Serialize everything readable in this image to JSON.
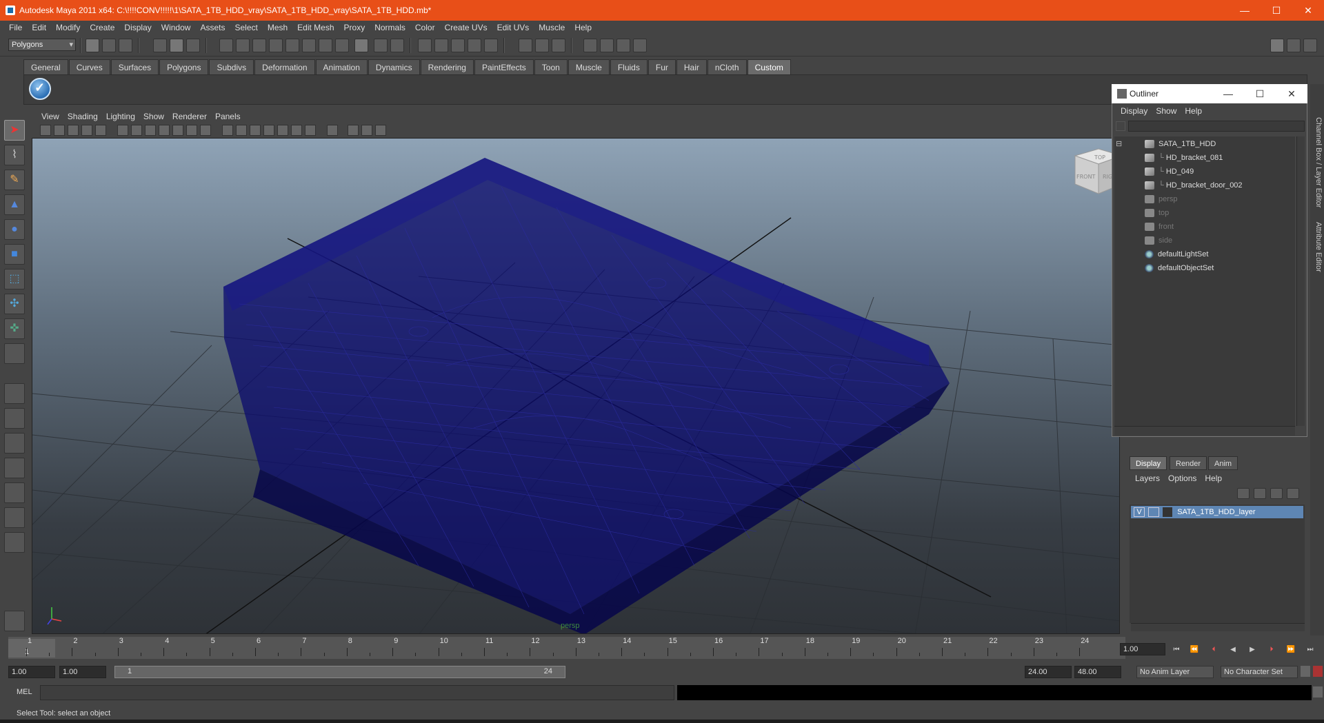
{
  "window": {
    "title": "Autodesk Maya 2011 x64: C:\\!!!!CONV!!!!!\\1\\SATA_1TB_HDD_vray\\SATA_1TB_HDD_vray\\SATA_1TB_HDD.mb*",
    "minimize": "—",
    "maximize": "☐",
    "close": "✕"
  },
  "menubar": [
    "File",
    "Edit",
    "Modify",
    "Create",
    "Display",
    "Window",
    "Assets",
    "Select",
    "Mesh",
    "Edit Mesh",
    "Proxy",
    "Normals",
    "Color",
    "Create UVs",
    "Edit UVs",
    "Muscle",
    "Help"
  ],
  "toolbar": {
    "mode": "Polygons"
  },
  "shelf": {
    "tabs": [
      "General",
      "Curves",
      "Surfaces",
      "Polygons",
      "Subdivs",
      "Deformation",
      "Animation",
      "Dynamics",
      "Rendering",
      "PaintEffects",
      "Toon",
      "Muscle",
      "Fluids",
      "Fur",
      "Hair",
      "nCloth",
      "Custom"
    ],
    "active": "Custom"
  },
  "viewport": {
    "menu": [
      "View",
      "Shading",
      "Lighting",
      "Show",
      "Renderer",
      "Panels"
    ],
    "camera_label": "persp",
    "viewcube": {
      "top": "TOP",
      "front": "FRONT",
      "right": "RIGHT"
    },
    "wire_color": "#0b0b6e"
  },
  "outliner": {
    "title": "Outliner",
    "menu": [
      "Display",
      "Show",
      "Help"
    ],
    "items": [
      {
        "label": "SATA_1TB_HDD",
        "depth": 0,
        "kind": "group",
        "expanded": "⊟"
      },
      {
        "label": "HD_bracket_081",
        "depth": 1,
        "kind": "mesh"
      },
      {
        "label": "HD_049",
        "depth": 1,
        "kind": "mesh"
      },
      {
        "label": "HD_bracket_door_002",
        "depth": 1,
        "kind": "mesh"
      },
      {
        "label": "persp",
        "depth": 0,
        "kind": "camera",
        "dim": true
      },
      {
        "label": "top",
        "depth": 0,
        "kind": "camera",
        "dim": true
      },
      {
        "label": "front",
        "depth": 0,
        "kind": "camera",
        "dim": true
      },
      {
        "label": "side",
        "depth": 0,
        "kind": "camera",
        "dim": true
      },
      {
        "label": "defaultLightSet",
        "depth": 0,
        "kind": "set"
      },
      {
        "label": "defaultObjectSet",
        "depth": 0,
        "kind": "set"
      }
    ]
  },
  "side_tabs": [
    "Channel Box / Layer Editor",
    "Attribute Editor"
  ],
  "layers": {
    "tabs": [
      "Display",
      "Render",
      "Anim"
    ],
    "active": "Display",
    "menu": [
      "Layers",
      "Options",
      "Help"
    ],
    "rows": [
      {
        "visible": "V",
        "name": "SATA_1TB_HDD_layer"
      }
    ]
  },
  "timeline": {
    "ticks": [
      "1",
      "2",
      "3",
      "4",
      "5",
      "6",
      "7",
      "8",
      "9",
      "10",
      "11",
      "12",
      "13",
      "14",
      "15",
      "16",
      "17",
      "18",
      "19",
      "20",
      "21",
      "22",
      "23",
      "24"
    ],
    "current_frame": "1",
    "current_time_field": "1.00"
  },
  "range": {
    "start": "1.00",
    "inner_start": "1.00",
    "slider_start": "1",
    "slider_end": "24",
    "end": "24.00",
    "outer_end": "48.00",
    "anim_layer": "No Anim Layer",
    "character_set": "No Character Set"
  },
  "command_line": {
    "label": "MEL"
  },
  "status": {
    "text": "Select Tool: select an object"
  }
}
